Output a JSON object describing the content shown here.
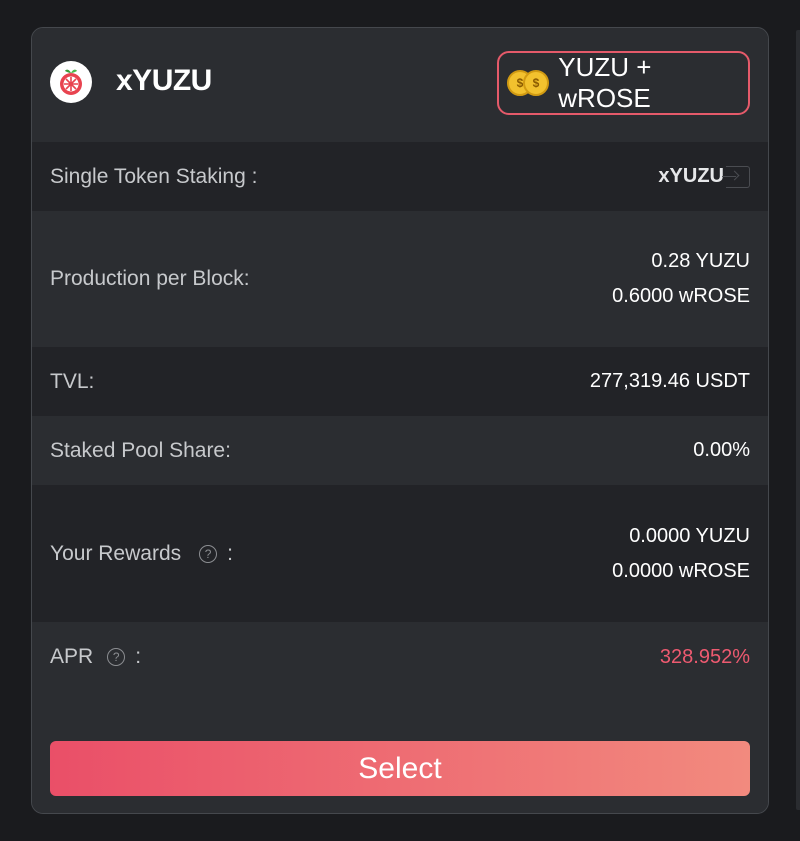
{
  "pool": {
    "title": "xYUZU",
    "pair_label": "YUZU + wROSE"
  },
  "rows": {
    "staking": {
      "label": "Single Token Staking :",
      "value": "xYUZU"
    },
    "production": {
      "label": "Production per Block:",
      "values": [
        "0.28 YUZU",
        "0.6000 wROSE"
      ]
    },
    "tvl": {
      "label": "TVL:",
      "value": "277,319.46 USDT"
    },
    "share": {
      "label": "Staked Pool Share:",
      "value": "0.00%"
    },
    "rewards": {
      "label": "Your Rewards",
      "colon": ":",
      "values": [
        "0.0000 YUZU",
        "0.0000 wROSE"
      ]
    },
    "apr": {
      "label": "APR",
      "colon": ":",
      "value": "328.952%"
    }
  },
  "actions": {
    "select_label": "Select"
  },
  "colors": {
    "accent": "#ea4f68",
    "apr": "#ee5a70",
    "coin": "#f2c12e"
  },
  "icons": [
    "yuzu-logo-icon",
    "coin-icon",
    "enter-icon",
    "help-icon"
  ]
}
